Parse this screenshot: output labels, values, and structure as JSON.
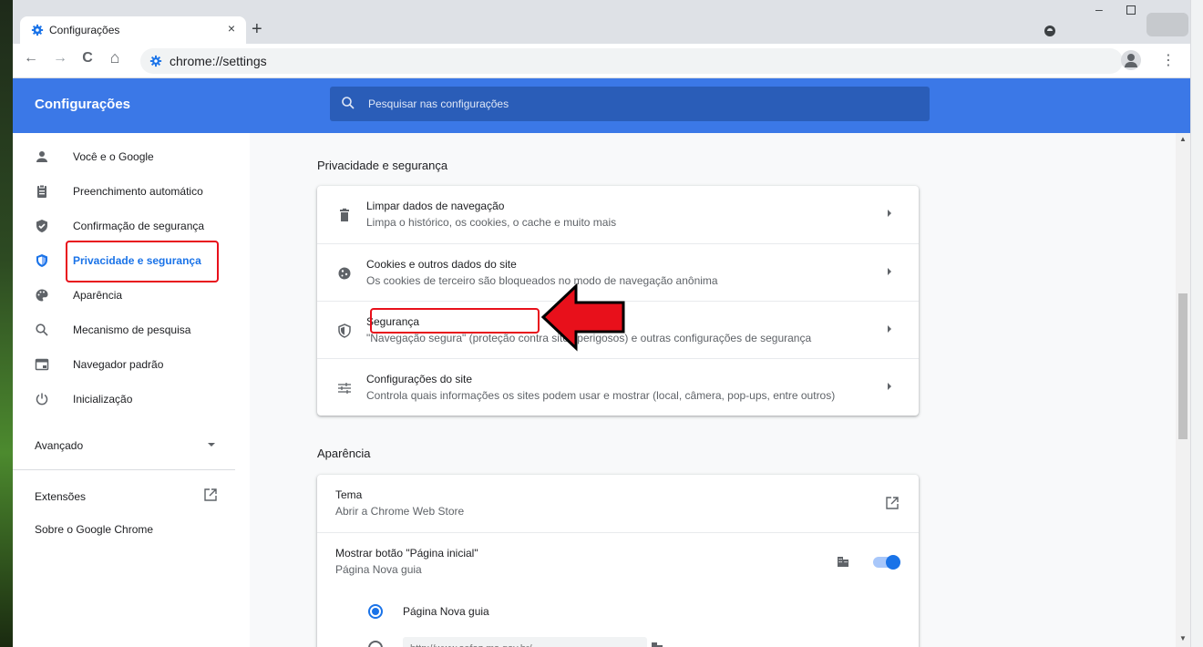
{
  "browser": {
    "tab_title": "Configurações",
    "tab_close": "×",
    "new_tab": "+",
    "url": "chrome://settings",
    "back": "←",
    "forward": "→",
    "reload": "C",
    "home": "⌂",
    "menu": "⋮",
    "minimize": "–"
  },
  "header": {
    "title": "Configurações",
    "search_placeholder": "Pesquisar nas configurações"
  },
  "sidebar": {
    "items": [
      {
        "label": "Você e o Google",
        "icon": "person-icon"
      },
      {
        "label": "Preenchimento automático",
        "icon": "clipboard-icon"
      },
      {
        "label": "Confirmação de segurança",
        "icon": "shield-check-icon"
      },
      {
        "label": "Privacidade e segurança",
        "icon": "shield-privacy-icon"
      },
      {
        "label": "Aparência",
        "icon": "palette-icon"
      },
      {
        "label": "Mecanismo de pesquisa",
        "icon": "search-icon"
      },
      {
        "label": "Navegador padrão",
        "icon": "browser-window-icon"
      },
      {
        "label": "Inicialização",
        "icon": "power-icon"
      }
    ],
    "advanced": "Avançado",
    "extensions": "Extensões",
    "about": "Sobre o Google Chrome"
  },
  "privacy": {
    "title": "Privacidade e segurança",
    "rows": [
      {
        "title": "Limpar dados de navegação",
        "desc": "Limpa o histórico, os cookies, o cache e muito mais",
        "icon": "trash-icon"
      },
      {
        "title": "Cookies e outros dados do site",
        "desc": "Os cookies de terceiro são bloqueados no modo de navegação anônima",
        "icon": "cookie-icon"
      },
      {
        "title": "Segurança",
        "desc": "\"Navegação segura\" (proteção contra sites perigosos) e outras configurações de segurança",
        "icon": "shield-icon"
      },
      {
        "title": "Configurações do site",
        "desc": "Controla quais informações os sites podem usar e mostrar (local, câmera, pop-ups, entre outros)",
        "icon": "sliders-icon"
      }
    ]
  },
  "appearance": {
    "title": "Aparência",
    "theme_title": "Tema",
    "theme_desc": "Abrir a Chrome Web Store",
    "home_title": "Mostrar botão \"Página inicial\"",
    "home_desc": "Página Nova guia",
    "radio_new_tab": "Página Nova guia",
    "url_value": "http://www.sefaz.ms.gov.br/"
  },
  "colors": {
    "header_blue": "#3b78e7",
    "search_blue": "#2a5db8",
    "accent": "#1a73e8",
    "highlight_red": "#e8101b"
  }
}
